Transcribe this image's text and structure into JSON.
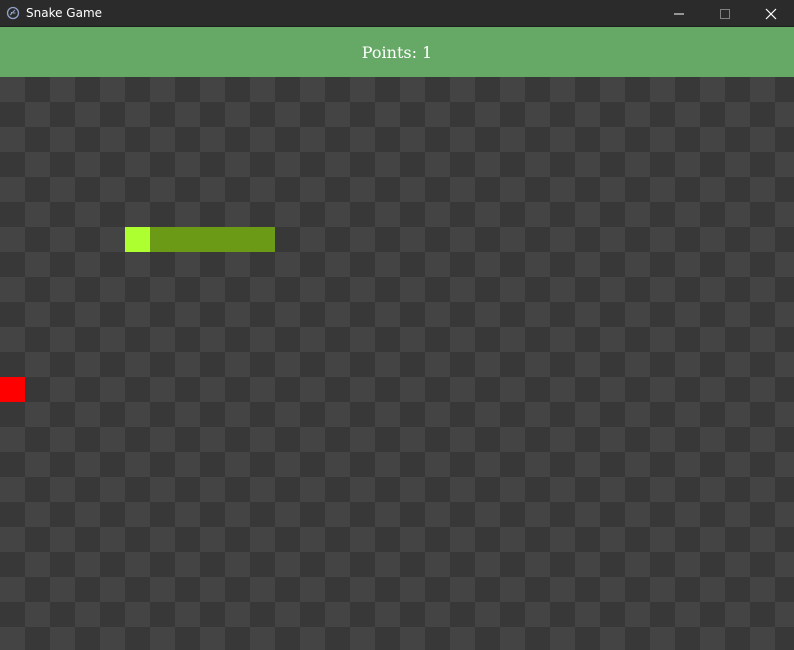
{
  "window": {
    "title": "Snake Game",
    "icon": "tk-feather-icon"
  },
  "score": {
    "label": "Points:",
    "value": "1"
  },
  "colors": {
    "scorebar": "#66a866",
    "board_dark": "#383838",
    "board_light": "#444444",
    "snake_head": "#adff2f",
    "snake_body": "#6b9a16",
    "food": "#ff0000"
  },
  "game": {
    "grid": {
      "cols": 32,
      "rows": 23
    },
    "snake": {
      "head": {
        "col": 5,
        "row": 6
      },
      "body": [
        {
          "col": 6,
          "row": 6
        },
        {
          "col": 7,
          "row": 6
        },
        {
          "col": 8,
          "row": 6
        },
        {
          "col": 9,
          "row": 6
        },
        {
          "col": 10,
          "row": 6
        }
      ]
    },
    "food": {
      "col": 0,
      "row": 12
    }
  }
}
